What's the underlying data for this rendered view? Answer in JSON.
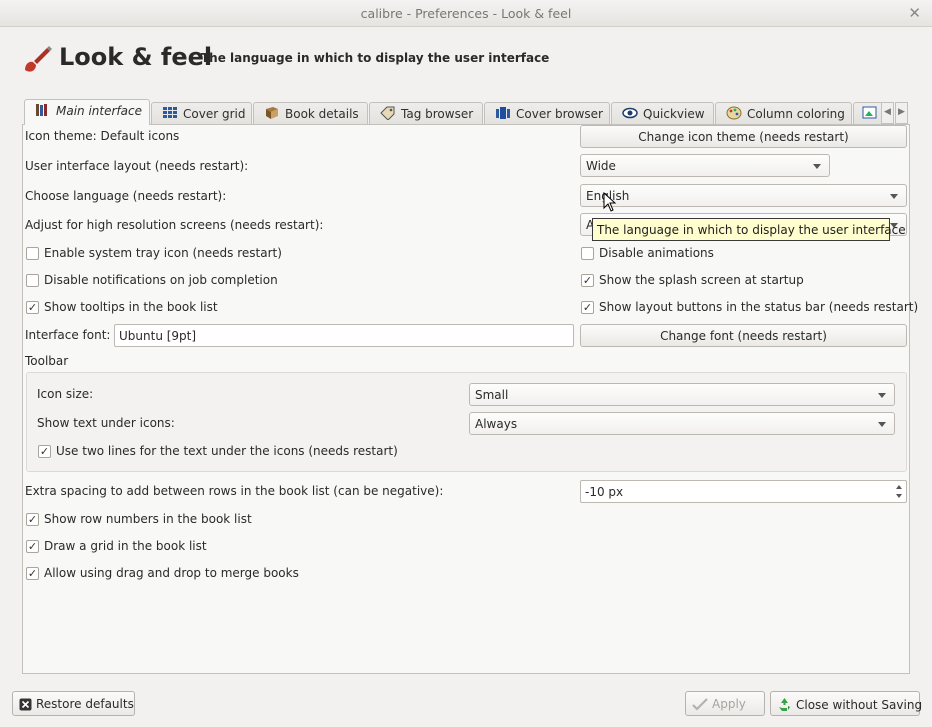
{
  "window": {
    "title": "calibre - Preferences - Look & feel",
    "close_glyph": "✕"
  },
  "header": {
    "icon": "paintbrush-icon",
    "title": "Look & feel",
    "subtitle": "The language in which to display the user interface"
  },
  "tabs": [
    {
      "label": "Main interface",
      "icon": "books-icon",
      "active": true
    },
    {
      "label": "Cover grid",
      "icon": "grid-icon"
    },
    {
      "label": "Book details",
      "icon": "book-icon"
    },
    {
      "label": "Tag browser",
      "icon": "tag-icon"
    },
    {
      "label": "Cover browser",
      "icon": "cover-flow-icon"
    },
    {
      "label": "Quickview",
      "icon": "eye-icon"
    },
    {
      "label": "Column coloring",
      "icon": "palette-icon"
    }
  ],
  "main": {
    "icon_theme_label": "Icon theme: Default icons",
    "change_icon_theme_button": "Change icon theme (needs restart)",
    "ui_layout_label": "User interface layout (needs restart):",
    "ui_layout_value": "Wide",
    "language_label": "Choose language (needs restart):",
    "language_value": "English",
    "high_res_label": "Adjust for high resolution screens (needs restart):",
    "high_res_value": "A",
    "tooltip_text": "The language in which to display the user interface",
    "checks": {
      "system_tray": {
        "label": "Enable system tray icon (needs restart)",
        "checked": false
      },
      "disable_animations": {
        "label": "Disable animations",
        "checked": false
      },
      "disable_notifications": {
        "label": "Disable notifications on job completion",
        "checked": false
      },
      "splash": {
        "label": "Show the splash screen at startup",
        "checked": true
      },
      "tooltips": {
        "label": "Show tooltips in the book list",
        "checked": true
      },
      "layout_buttons": {
        "label": "Show layout buttons in the status bar (needs restart)",
        "checked": true
      }
    },
    "interface_font_label": "Interface font:",
    "interface_font_value": "Ubuntu [9pt]",
    "change_font_button": "Change font (needs restart)",
    "toolbar_heading": "Toolbar",
    "icon_size_label": "Icon size:",
    "icon_size_value": "Small",
    "show_text_label": "Show text under icons:",
    "show_text_value": "Always",
    "two_lines": {
      "label": "Use two lines for the text under the icons (needs restart)",
      "checked": true
    },
    "spacing_label": "Extra spacing to add between rows in the book list (can be negative):",
    "spacing_value": "-10 px",
    "row_numbers": {
      "label": "Show row numbers in the book list",
      "checked": true
    },
    "draw_grid": {
      "label": "Draw a grid in the book list",
      "checked": true
    },
    "drag_drop": {
      "label": "Allow using drag and drop to merge books",
      "checked": true
    }
  },
  "footer": {
    "restore_defaults": "Restore defaults",
    "apply": "Apply",
    "close_without_saving": "Close without Saving"
  },
  "check_glyph": "✓"
}
